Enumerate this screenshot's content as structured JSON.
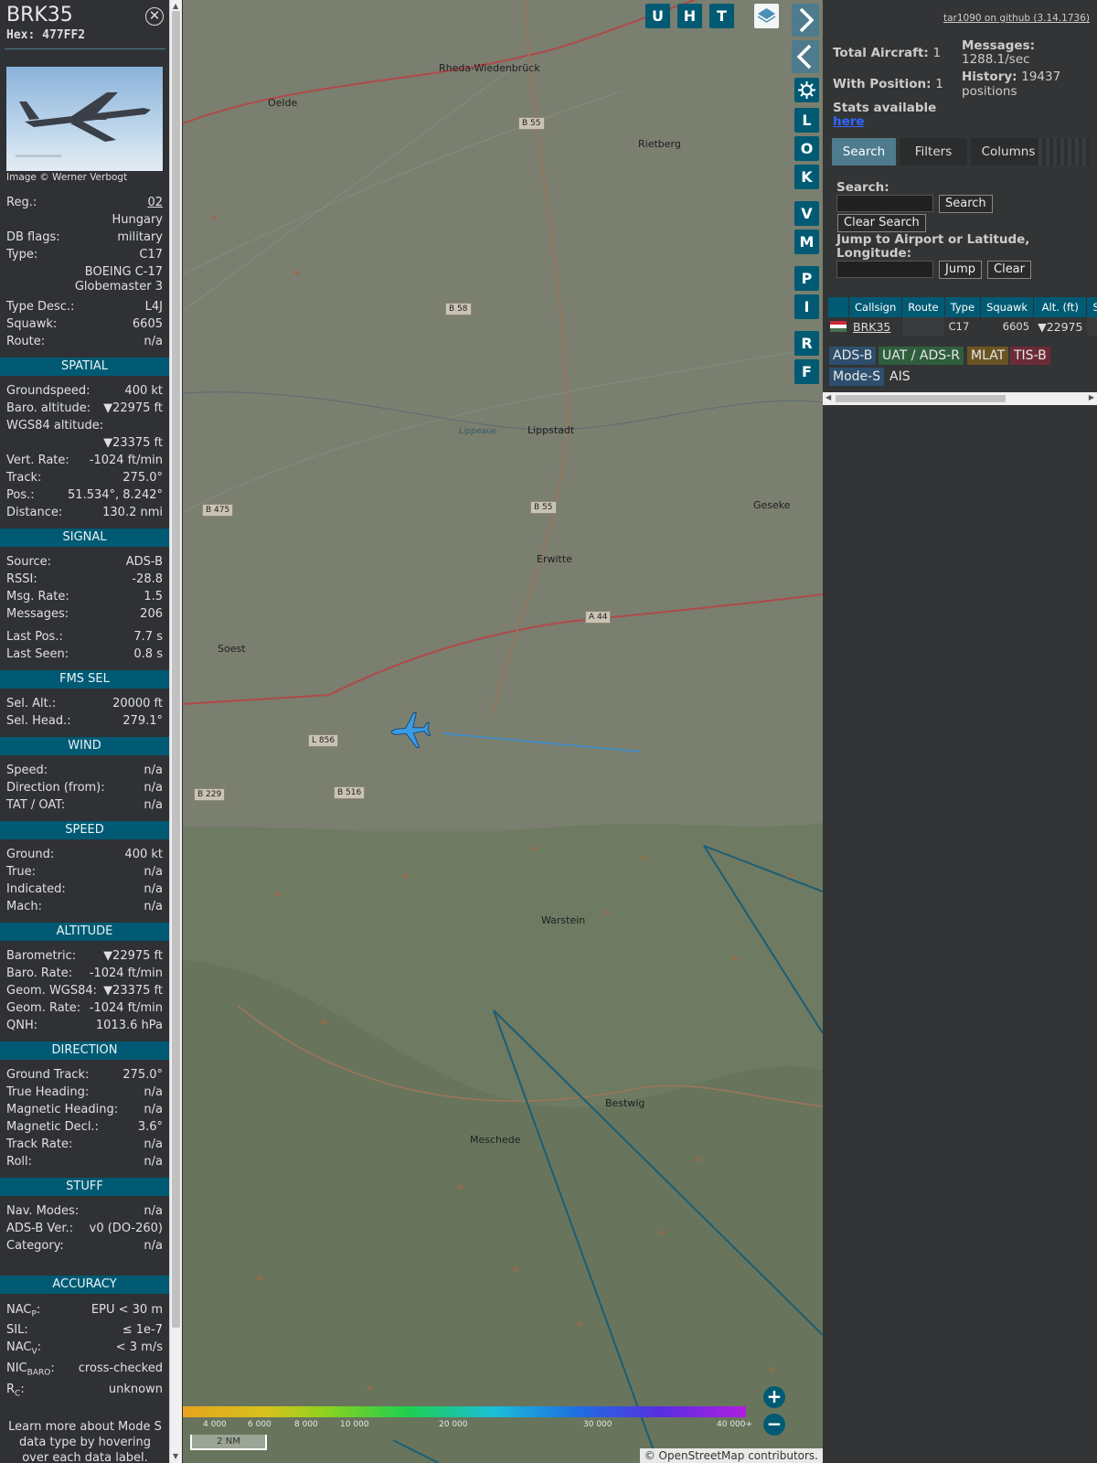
{
  "header": {
    "callsign": "BRK35",
    "hex_label": "Hex:",
    "hex": "477FF2"
  },
  "photo_credit": "Image © Werner Verbogt",
  "info": {
    "reg_label": "Reg.:",
    "reg": "02",
    "country": "Hungary",
    "dbflags_label": "DB flags:",
    "dbflags": "military",
    "type_label": "Type:",
    "type": "C17",
    "type_name": "BOEING C-17 Globemaster 3",
    "typedesc_label": "Type Desc.:",
    "typedesc": "L4J",
    "squawk_label": "Squawk:",
    "squawk": "6605",
    "route_label": "Route:",
    "route": "n/a"
  },
  "sections": {
    "spatial": "SPATIAL",
    "signal": "SIGNAL",
    "fms": "FMS SEL",
    "wind": "WIND",
    "speed": "SPEED",
    "altitude": "ALTITUDE",
    "direction": "DIRECTION",
    "stuff": "STUFF",
    "accuracy": "ACCURACY"
  },
  "spatial": {
    "gs_label": "Groundspeed:",
    "gs": "400 kt",
    "baro_label": "Baro. altitude:",
    "baro": "▼22975 ft",
    "wgs_label": "WGS84 altitude:",
    "wgs": "▼23375 ft",
    "vr_label": "Vert. Rate:",
    "vr": "-1024 ft/min",
    "track_label": "Track:",
    "track": "275.0°",
    "pos_label": "Pos.:",
    "pos": "51.534°, 8.242°",
    "dist_label": "Distance:",
    "dist": "130.2 nmi"
  },
  "signal": {
    "src_label": "Source:",
    "src": "ADS-B",
    "rssi_label": "RSSI:",
    "rssi": "-28.8",
    "rate_label": "Msg. Rate:",
    "rate": "1.5",
    "msgs_label": "Messages:",
    "msgs": "206",
    "lastpos_label": "Last Pos.:",
    "lastpos": "7.7 s",
    "lastseen_label": "Last Seen:",
    "lastseen": "0.8 s"
  },
  "fms": {
    "alt_label": "Sel. Alt.:",
    "alt": "20000 ft",
    "head_label": "Sel. Head.:",
    "head": "279.1°"
  },
  "wind": {
    "speed_label": "Speed:",
    "speed": "n/a",
    "dir_label": "Direction (from):",
    "dir": "n/a",
    "tat_label": "TAT / OAT:",
    "tat": "n/a"
  },
  "speed": {
    "ground_label": "Ground:",
    "ground": "400 kt",
    "true_label": "True:",
    "true": "n/a",
    "ind_label": "Indicated:",
    "ind": "n/a",
    "mach_label": "Mach:",
    "mach": "n/a"
  },
  "altitude": {
    "baro_label": "Barometric:",
    "baro": "▼22975 ft",
    "brate_label": "Baro. Rate:",
    "brate": "-1024 ft/min",
    "geom_label": "Geom. WGS84:",
    "geom": "▼23375 ft",
    "grate_label": "Geom. Rate:",
    "grate": "-1024 ft/min",
    "qnh_label": "QNH:",
    "qnh": "1013.6 hPa"
  },
  "direction": {
    "gt_label": "Ground Track:",
    "gt": "275.0°",
    "th_label": "True Heading:",
    "th": "n/a",
    "mh_label": "Magnetic Heading:",
    "mh": "n/a",
    "md_label": "Magnetic Decl.:",
    "md": "3.6°",
    "tr_label": "Track Rate:",
    "tr": "n/a",
    "roll_label": "Roll:",
    "roll": "n/a"
  },
  "stuff": {
    "nav_label": "Nav. Modes:",
    "nav": "n/a",
    "adsb_label": "ADS-B Ver.:",
    "adsb": "v0 (DO-260)",
    "cat_label": "Category:",
    "cat": "n/a"
  },
  "accuracy": {
    "nacp_label": "NAC",
    "nacp_sub": "P",
    "nacp": "EPU < 30 m",
    "sil_label": "SIL:",
    "sil": "≤ 1e-7",
    "nacv_label": "NAC",
    "nacv_sub": "V",
    "nacv": "< 3 m/s",
    "nic_label": "NIC",
    "nic_sub": "BARO",
    "nic": "cross-checked",
    "rc_label": "R",
    "rc_sub": "C",
    "rc": "unknown"
  },
  "footer_note": "Learn more about Mode S data type by hovering over each data label.",
  "map": {
    "places": [
      "Rheda-Wiedenbrück",
      "Oelde",
      "Rietberg",
      "Lippstadt",
      "Geseke",
      "Erwitte",
      "Soest",
      "Warstein",
      "Bestwig",
      "Meschede",
      "Lippeaue"
    ],
    "roads": [
      "B 55",
      "B 58",
      "B 475",
      "B 55",
      "A 44",
      "L 856",
      "B 229",
      "B 516"
    ],
    "scale_ticks": [
      "4 000",
      "6 000",
      "8 000",
      "10 000",
      "20 000",
      "30 000",
      "40 000+"
    ],
    "scale_label": "2 NM",
    "credit_osm": "© OpenStreetMap",
    "credit_contrib": "contributors."
  },
  "map_buttons": [
    "U",
    "H",
    "T",
    "L",
    "O",
    "K",
    "V",
    "M",
    "P",
    "I",
    "R",
    "F"
  ],
  "icons": [
    "layers-icon",
    "chevron-right-icon",
    "chevron-left-icon",
    "expand-icon",
    "gear-icon",
    "zoom-in-icon",
    "zoom-out-icon",
    "close-icon",
    "aircraft-icon"
  ],
  "right": {
    "github": "tar1090 on github (3.14.1736)",
    "total_label": "Total Aircraft:",
    "total": "1",
    "withpos_label": "With Position:",
    "withpos": "1",
    "messages_label": "Messages:",
    "messages": "1288.1/sec",
    "history_label": "History:",
    "history": "19437 positions",
    "stats_label": "Stats available",
    "stats_link": "here",
    "tabs": [
      "Search",
      "Filters",
      "Columns"
    ],
    "search_label": "Search:",
    "search_btn": "Search",
    "clear_search": "Clear Search",
    "jump_label": "Jump to Airport or Latitude, Longitude:",
    "jump_btn": "Jump",
    "clear_btn": "Clear",
    "columns": [
      "Callsign",
      "Route",
      "Type",
      "Squawk",
      "Alt. (ft)",
      "Spd"
    ],
    "row": {
      "callsign": "BRK35",
      "route": "",
      "type": "C17",
      "squawk": "6605",
      "alt": "▼22975"
    },
    "sources": [
      "ADS-B",
      "UAT / ADS-R",
      "MLAT",
      "TIS-B",
      "Mode-S",
      "AIS"
    ]
  },
  "colors": {
    "accent": "#005a73",
    "panel": "#2f3134",
    "track": "#3a8fd6",
    "adsb": "#2d4f6d",
    "uat": "#2f5e3d",
    "mlat": "#6b5424",
    "tisb": "#6b2c38"
  }
}
